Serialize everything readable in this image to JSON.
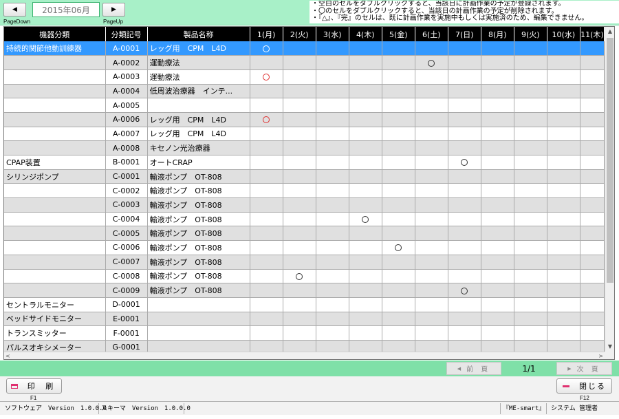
{
  "nav": {
    "prev_label": "◀",
    "next_label": "▶",
    "month": "2015年06月",
    "page_down": "PageDown",
    "page_up": "PageUp"
  },
  "notes": [
    "・空白のセルをダブルクリックすると、当該日に計画作業の予定が登録されます。",
    "・〇のセルをダブルクリックすると、当該日の計画作業の予定が削除されます。",
    "・『△』、『完』のセルは、既に計画作業を実施中もしくは実施済のため、編集できません。"
  ],
  "columns": [
    "機器分類",
    "分類記号",
    "製品名称",
    "1(月)",
    "2(火)",
    "3(水)",
    "4(木)",
    "5(金)",
    "6(土)",
    "7(日)",
    "8(月)",
    "9(火)",
    "10(水)",
    "11(木)"
  ],
  "rows": [
    {
      "category": "持続的関節他動訓練器",
      "code": "A-0001",
      "product": "レッグ用　CPM　L4D",
      "marks": {
        "1": "o"
      },
      "selected": true
    },
    {
      "category": "",
      "code": "A-0002",
      "product": "運動療法",
      "marks": {
        "6": "o"
      }
    },
    {
      "category": "",
      "code": "A-0003",
      "product": "運動療法",
      "marks": {
        "1": "r"
      }
    },
    {
      "category": "",
      "code": "A-0004",
      "product": "低周波治療器　インテ...",
      "marks": {}
    },
    {
      "category": "",
      "code": "A-0005",
      "product": "",
      "marks": {}
    },
    {
      "category": "",
      "code": "A-0006",
      "product": "レッグ用　CPM　L4D",
      "marks": {
        "1": "r"
      }
    },
    {
      "category": "",
      "code": "A-0007",
      "product": "レッグ用　CPM　L4D",
      "marks": {}
    },
    {
      "category": "",
      "code": "A-0008",
      "product": "キセノン光治療器",
      "marks": {}
    },
    {
      "category": "CPAP装置",
      "code": "B-0001",
      "product": "オートCRAP",
      "marks": {
        "7": "o"
      }
    },
    {
      "category": "シリンジポンプ",
      "code": "C-0001",
      "product": "輸液ポンプ　OT-808",
      "marks": {}
    },
    {
      "category": "",
      "code": "C-0002",
      "product": "輸液ポンプ　OT-808",
      "marks": {}
    },
    {
      "category": "",
      "code": "C-0003",
      "product": "輸液ポンプ　OT-808",
      "marks": {}
    },
    {
      "category": "",
      "code": "C-0004",
      "product": "輸液ポンプ　OT-808",
      "marks": {
        "4": "o"
      }
    },
    {
      "category": "",
      "code": "C-0005",
      "product": "輸液ポンプ　OT-808",
      "marks": {}
    },
    {
      "category": "",
      "code": "C-0006",
      "product": "輸液ポンプ　OT-808",
      "marks": {
        "5": "o"
      }
    },
    {
      "category": "",
      "code": "C-0007",
      "product": "輸液ポンプ　OT-808",
      "marks": {}
    },
    {
      "category": "",
      "code": "C-0008",
      "product": "輸液ポンプ　OT-808",
      "marks": {
        "2": "o"
      }
    },
    {
      "category": "",
      "code": "C-0009",
      "product": "輸液ポンプ　OT-808",
      "marks": {
        "7": "o"
      }
    },
    {
      "category": "セントラルモニター",
      "code": "D-0001",
      "product": "",
      "marks": {}
    },
    {
      "category": "ベッドサイドモニター",
      "code": "E-0001",
      "product": "",
      "marks": {}
    },
    {
      "category": "トランスミッター",
      "code": "F-0001",
      "product": "",
      "marks": {}
    },
    {
      "category": "パルスオキシメーター",
      "code": "G-0001",
      "product": "",
      "marks": {}
    }
  ],
  "pager": {
    "prev_label": "前 頁",
    "next_label": "次 頁",
    "count": "1/1"
  },
  "actions": {
    "print_label": "印 刷",
    "close_label": "閉じる",
    "print_key": "F1",
    "close_key": "F12"
  },
  "status": {
    "software_version": "ソフトウェア　Version　1.0.0.0",
    "schema_version": "スキーマ　Version　1.0.0.0",
    "app_name": "『ME-smart』",
    "user": "システム 管理者"
  },
  "colors": {
    "header_bg": "#a8f0c8",
    "pager_bg": "#7fe0a8",
    "selected_row": "#3399ff",
    "red_mark": "#e03030",
    "accent_pink": "#e03070"
  }
}
